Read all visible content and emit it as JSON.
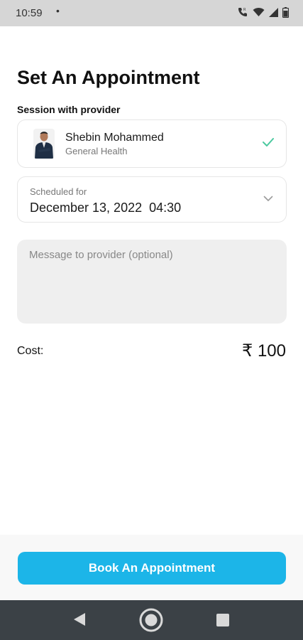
{
  "status_bar": {
    "time": "10:59",
    "dot": "•"
  },
  "page": {
    "title": "Set An Appointment",
    "section_label": "Session with provider"
  },
  "provider": {
    "name": "Shebin Mohammed",
    "specialty": "General Health",
    "selected_icon": "check-icon",
    "check_color": "#4cc9a0"
  },
  "schedule": {
    "label": "Scheduled for",
    "value": "December 13, 2022  04:30",
    "dropdown_icon": "chevron-down-icon"
  },
  "message": {
    "placeholder": "Message to provider (optional)",
    "value": ""
  },
  "cost": {
    "label": "Cost:",
    "value": "₹ 100"
  },
  "actions": {
    "book_label": "Book An Appointment",
    "accent_color": "#1cb5e8"
  },
  "navigation": {
    "back_icon": "back-triangle-icon",
    "home_icon": "home-circle-icon",
    "recent_icon": "recent-square-icon"
  }
}
